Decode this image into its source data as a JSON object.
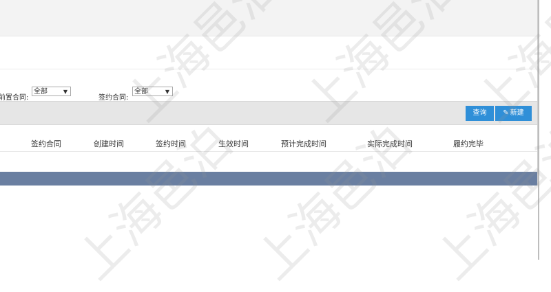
{
  "filters": {
    "pre_contract_label": "前置合同:",
    "pre_contract_value": "全部",
    "signed_contract_label": "签约合同:",
    "signed_contract_value": "全部"
  },
  "toolbar": {
    "query_label": "查询",
    "new_label": "新建"
  },
  "table": {
    "columns": [
      "签约合同",
      "创建时间",
      "签约时间",
      "生效时间",
      "预计完成时间",
      "实际完成时间",
      "履约完毕"
    ]
  },
  "watermark": "上海邑泊"
}
